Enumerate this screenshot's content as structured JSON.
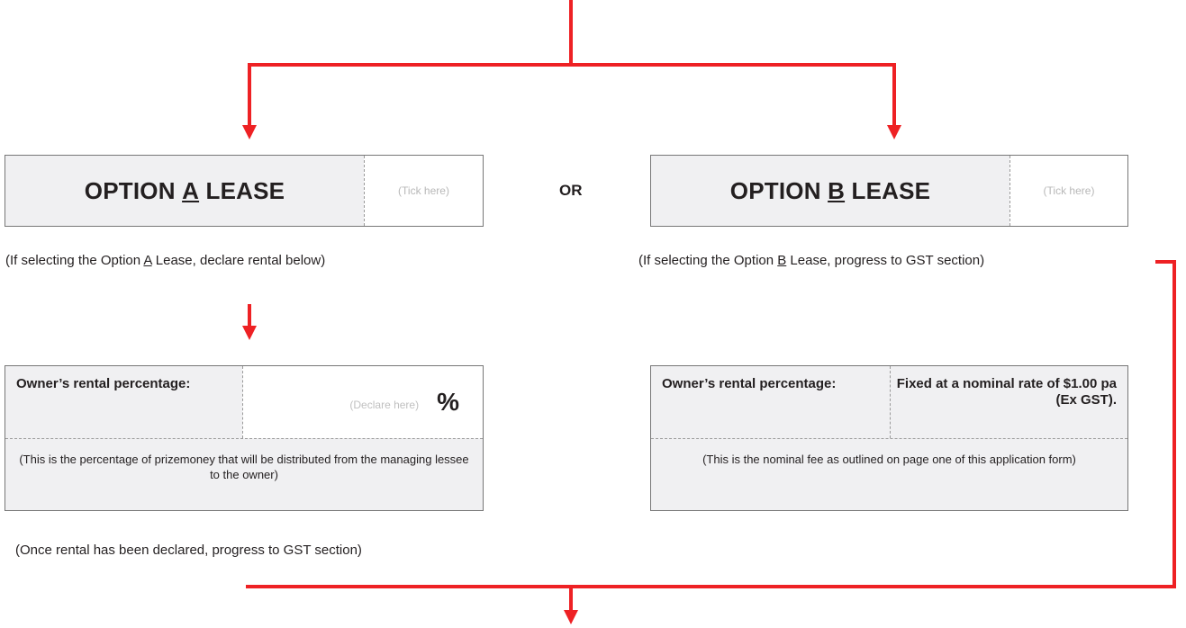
{
  "connector_color": "#ee2124",
  "option_a": {
    "title_prefix": "OPTION ",
    "title_letter": "A",
    "title_suffix": " LEASE",
    "tick_hint": "(Tick here)",
    "note_prefix": "(If selecting the Option ",
    "note_letter": "A",
    "note_suffix": " Lease, declare rental below)",
    "rental_label": "Owner’s rental percentage:",
    "declare_hint": "(Declare here)",
    "percent_sign": "%",
    "description": "(This is the percentage of prizemoney that will be distributed from the managing lessee to the owner)",
    "after_note": "(Once rental has been declared, progress to GST section)"
  },
  "or_label": "OR",
  "option_b": {
    "title_prefix": "OPTION ",
    "title_letter": "B",
    "title_suffix": " LEASE",
    "tick_hint": "(Tick here)",
    "note_prefix": "(If selecting the Option ",
    "note_letter": "B",
    "note_suffix": " Lease, progress to GST section)",
    "rental_label": "Owner’s rental percentage:",
    "fixed_rate": "Fixed at a nominal rate of $1.00 pa (Ex GST).",
    "description": "(This is the nominal fee as outlined on page one of this application form)"
  }
}
